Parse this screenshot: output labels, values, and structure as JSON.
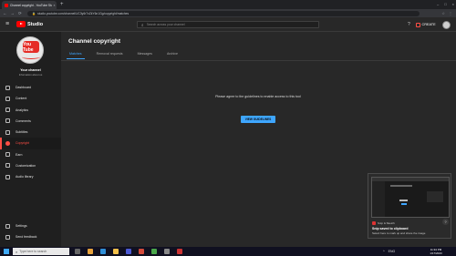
{
  "browser": {
    "tab_title": "Channel copyright - YouTube Studio",
    "tab_close": "×",
    "new_tab": "+",
    "url": "studio.youtube.com/channel/UC3y6r7xZkY6n1Gg/copyright/matches",
    "lock_glyph": "🔒",
    "back_glyph": "←",
    "forward_glyph": "→",
    "reload_glyph": "⟳",
    "window_controls": [
      "–",
      "□",
      "×"
    ],
    "right_icons": [
      "☆",
      "⋮"
    ]
  },
  "header": {
    "menu_glyph": "≡",
    "studio_label": "Studio",
    "search_placeholder": "Search across your channel",
    "search_glyph": "⌕",
    "help_glyph": "?",
    "create_label": "CREATE"
  },
  "sidebar": {
    "avatar_text": "You Tube",
    "channel_name": "Your channel",
    "channel_sub": "Information about us",
    "items": [
      {
        "label": "Dashboard",
        "icon": "dashboard-icon"
      },
      {
        "label": "Content",
        "icon": "content-icon"
      },
      {
        "label": "Analytics",
        "icon": "analytics-icon"
      },
      {
        "label": "Comments",
        "icon": "comments-icon"
      },
      {
        "label": "Subtitles",
        "icon": "subtitles-icon"
      },
      {
        "label": "Copyright",
        "icon": "copyright-icon",
        "active": true
      },
      {
        "label": "Earn",
        "icon": "earn-icon"
      },
      {
        "label": "Customization",
        "icon": "customization-icon"
      },
      {
        "label": "Audio library",
        "icon": "audio-library-icon"
      }
    ],
    "bottom_items": [
      {
        "label": "Settings",
        "icon": "gear-icon"
      },
      {
        "label": "Send feedback",
        "icon": "feedback-icon"
      }
    ]
  },
  "main": {
    "title": "Channel copyright",
    "tabs": [
      "Matches",
      "Removal requests",
      "Messages",
      "Archive"
    ],
    "active_tab": "Matches",
    "agreement_text": "Please agree to the guidelines to enable access to this tool",
    "button_label": "VIEW GUIDELINES"
  },
  "notification": {
    "app_name": "Snip & Sketch",
    "title": "Snip saved to clipboard",
    "description": "Select here to mark up and share the image"
  },
  "taskbar": {
    "search_placeholder": "Type here to search",
    "time": "11:34 PM",
    "date": "1/17/2023",
    "tray": [
      "^",
      "ENG"
    ]
  },
  "colors": {
    "accent_red": "#ff4e45",
    "accent_blue": "#3ea6ff",
    "background": "#282828",
    "sidebar": "#1f1f1f"
  }
}
